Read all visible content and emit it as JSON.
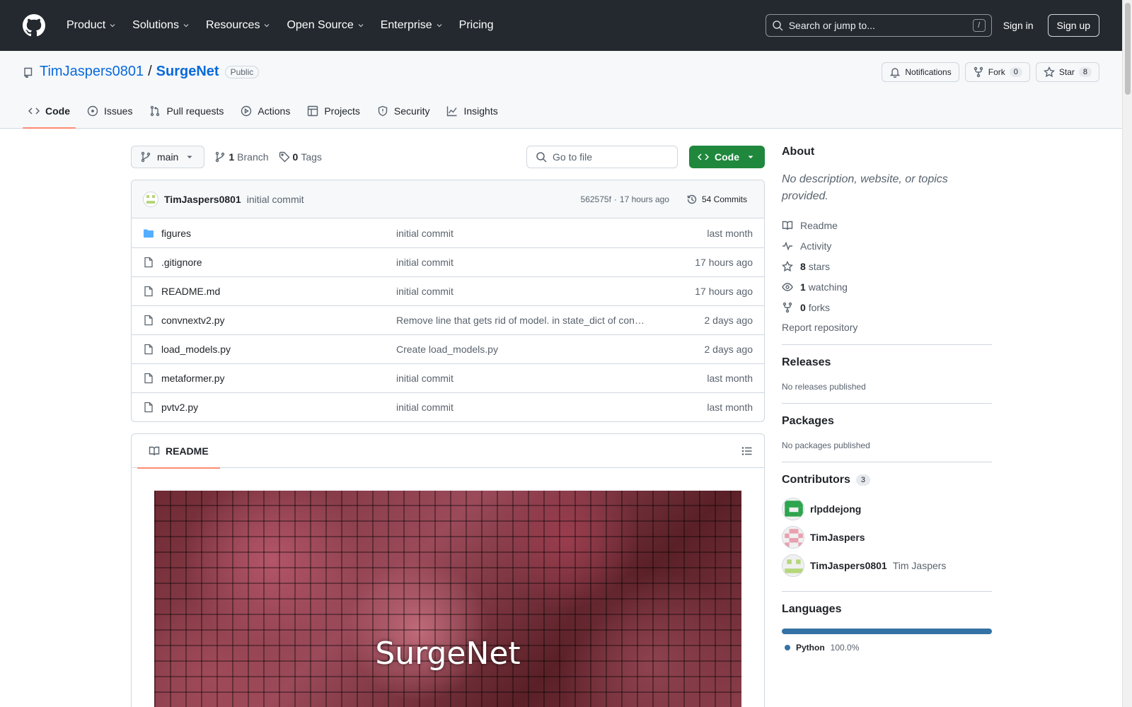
{
  "header": {
    "nav": [
      "Product",
      "Solutions",
      "Resources",
      "Open Source",
      "Enterprise",
      "Pricing"
    ],
    "search_placeholder": "Search or jump to...",
    "search_key": "/",
    "signin": "Sign in",
    "signup": "Sign up"
  },
  "repo": {
    "owner": "TimJaspers0801",
    "separator": "/",
    "name": "SurgeNet",
    "visibility": "Public",
    "notifications": "Notifications",
    "fork_label": "Fork",
    "fork_count": "0",
    "star_label": "Star",
    "star_count": "8",
    "tabs": [
      "Code",
      "Issues",
      "Pull requests",
      "Actions",
      "Projects",
      "Security",
      "Insights"
    ]
  },
  "toolbar": {
    "branch": "main",
    "branches_count": "1",
    "branches_label": "Branch",
    "tags_count": "0",
    "tags_label": "Tags",
    "goto_placeholder": "Go to file",
    "code_label": "Code"
  },
  "commit": {
    "author": "TimJaspers0801",
    "message": "initial commit",
    "hash": "562575f",
    "dot": "·",
    "time": "17 hours ago",
    "commits": "54 Commits"
  },
  "files": [
    {
      "name": "figures",
      "type": "dir",
      "message": "initial commit",
      "date": "last month"
    },
    {
      "name": ".gitignore",
      "type": "file",
      "message": "initial commit",
      "date": "17 hours ago"
    },
    {
      "name": "README.md",
      "type": "file",
      "message": "initial commit",
      "date": "17 hours ago"
    },
    {
      "name": "convnextv2.py",
      "type": "file",
      "message": "Remove line that gets rid of model. in state_dict of convnex…",
      "date": "2 days ago"
    },
    {
      "name": "load_models.py",
      "type": "file",
      "message": "Create load_models.py",
      "date": "2 days ago"
    },
    {
      "name": "metaformer.py",
      "type": "file",
      "message": "initial commit",
      "date": "last month"
    },
    {
      "name": "pvtv2.py",
      "type": "file",
      "message": "initial commit",
      "date": "last month"
    }
  ],
  "readme": {
    "tab": "README",
    "banner_title": "SurgeNet"
  },
  "about": {
    "title": "About",
    "description": "No description, website, or topics provided.",
    "readme": "Readme",
    "activity": "Activity",
    "stars_count": "8",
    "stars_label": "stars",
    "watching_count": "1",
    "watching_label": "watching",
    "forks_count": "0",
    "forks_label": "forks",
    "report": "Report repository"
  },
  "releases": {
    "title": "Releases",
    "empty": "No releases published"
  },
  "packages": {
    "title": "Packages",
    "empty": "No packages published"
  },
  "contributors": {
    "title": "Contributors",
    "count": "3",
    "people": [
      {
        "login": "rlpddejong",
        "name": "",
        "color": "#2da44e"
      },
      {
        "login": "TimJaspers",
        "name": "",
        "color": "#e8a0b0"
      },
      {
        "login": "TimJaspers0801",
        "name": "Tim Jaspers",
        "color": "#b5d67a"
      }
    ]
  },
  "languages": {
    "title": "Languages",
    "items": [
      {
        "name": "Python",
        "percent": "100.0%",
        "color": "#3572A5"
      }
    ]
  }
}
